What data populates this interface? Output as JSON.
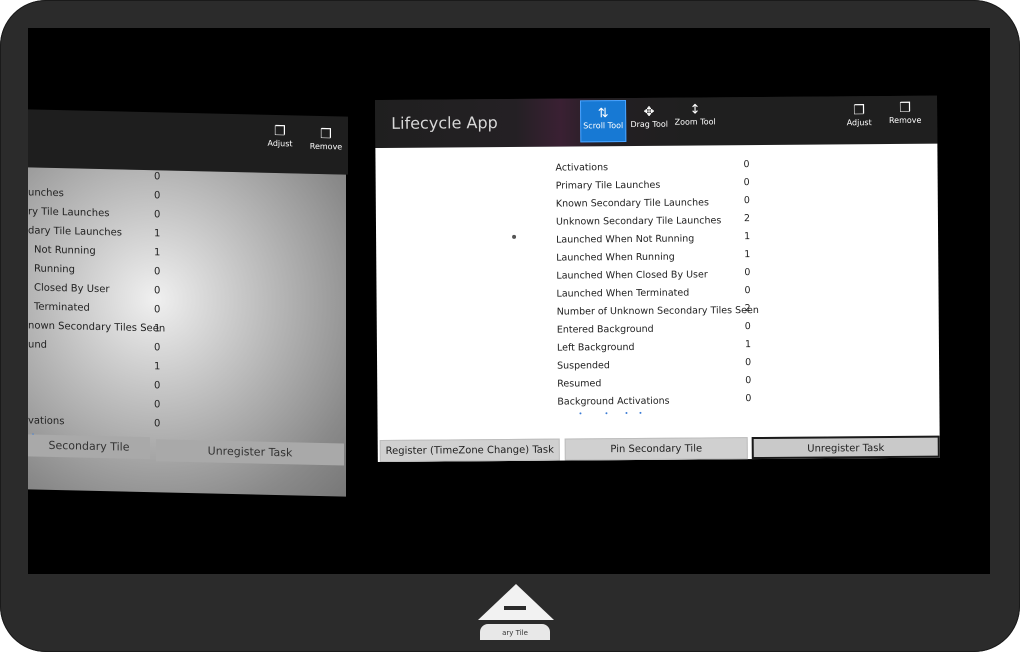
{
  "main_window": {
    "title": "Lifecycle App",
    "toolbar": {
      "scroll_tool": "Scroll Tool",
      "drag_tool": "Drag Tool",
      "zoom_tool": "Zoom Tool",
      "adjust": "Adjust",
      "remove": "Remove"
    },
    "rows": [
      {
        "label": "Activations",
        "value": "0"
      },
      {
        "label": "Primary Tile Launches",
        "value": "0"
      },
      {
        "label": "Known Secondary Tile Launches",
        "value": "0"
      },
      {
        "label": "Unknown Secondary Tile Launches",
        "value": "2"
      },
      {
        "label": "Launched When Not Running",
        "value": "1"
      },
      {
        "label": "Launched When Running",
        "value": "1"
      },
      {
        "label": "Launched When Closed By User",
        "value": "0"
      },
      {
        "label": "Launched When Terminated",
        "value": "0"
      },
      {
        "label": "Number of Unknown Secondary Tiles Seen",
        "value": "2"
      },
      {
        "label": "Entered Background",
        "value": "0"
      },
      {
        "label": "Left Background",
        "value": "1"
      },
      {
        "label": "Suspended",
        "value": "0"
      },
      {
        "label": "Resumed",
        "value": "0"
      },
      {
        "label": "Background Activations",
        "value": "0"
      }
    ],
    "buttons": {
      "register": "Register (TimeZone Change) Task",
      "pin": "Pin Secondary Tile",
      "unregister": "Unregister Task"
    }
  },
  "left_window": {
    "toolbar": {
      "adjust": "Adjust",
      "remove": "Remove"
    },
    "rows": [
      {
        "label": "",
        "value": "0"
      },
      {
        "label": "unches",
        "value": "0"
      },
      {
        "label": "ry Tile Launches",
        "value": "0"
      },
      {
        "label": "dary Tile Launches",
        "value": "1"
      },
      {
        "label": "Not Running",
        "value": "1"
      },
      {
        "label": "Running",
        "value": "0"
      },
      {
        "label": "Closed By User",
        "value": "0"
      },
      {
        "label": "Terminated",
        "value": "0"
      },
      {
        "label": "nown Secondary Tiles Seen",
        "value": "1"
      },
      {
        "label": "und",
        "value": "0"
      },
      {
        "label": "",
        "value": "1"
      },
      {
        "label": "",
        "value": "0"
      },
      {
        "label": "",
        "value": "0"
      },
      {
        "label": "vations",
        "value": "0"
      }
    ],
    "buttons": {
      "pin": "Secondary Tile",
      "unregister": "Unregister Task"
    }
  },
  "taskbar_tab": "ary Tile"
}
